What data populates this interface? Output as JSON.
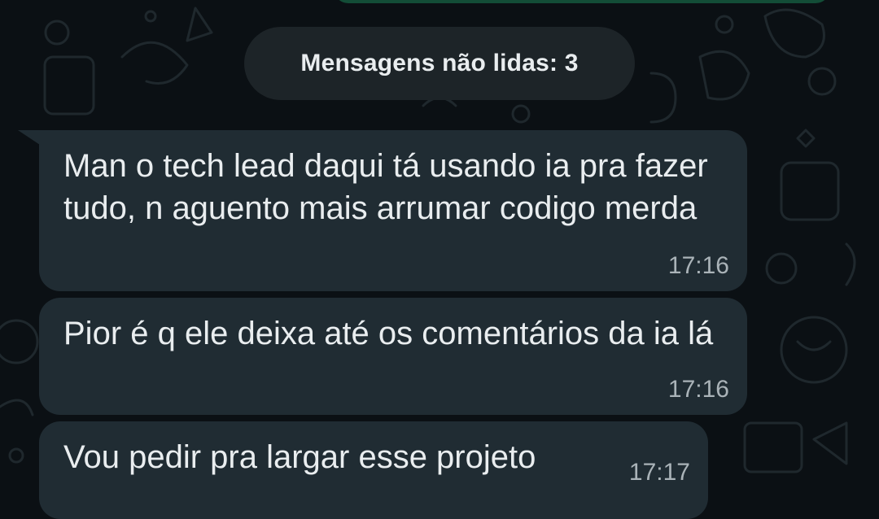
{
  "chat": {
    "unread_separator": "Mensagens não lidas: 3",
    "messages": [
      {
        "text": "Man o tech lead daqui tá usando ia pra fazer tudo, n aguento mais arrumar codigo merda",
        "time": "17:16"
      },
      {
        "text": "Pior é q ele deixa até os comentários da ia lá",
        "time": "17:16"
      },
      {
        "text": "Vou pedir pra largar esse projeto",
        "time": "17:17"
      }
    ]
  },
  "colors": {
    "background": "#0b1014",
    "incoming_bubble": "#202c33",
    "outgoing_bubble": "#134d37",
    "separator": "#1d2428",
    "text": "#e9edef",
    "timestamp": "#aab3b8"
  }
}
